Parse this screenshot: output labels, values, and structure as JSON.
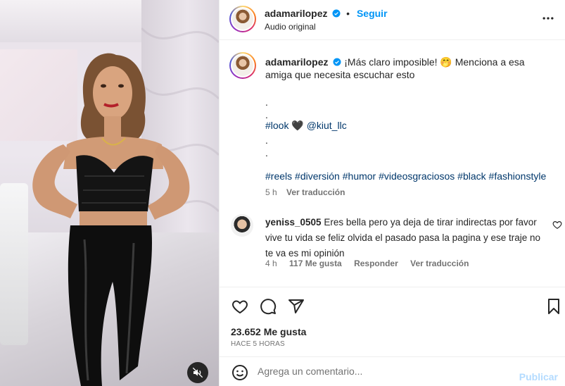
{
  "post": {
    "username": "adamarilopez",
    "follow_label": "Seguir",
    "audio_label": "Audio original",
    "caption_main": "¡Más claro imposible! 🤭 Menciona a esa amiga que necesita escuchar esto",
    "dot": ".",
    "look_tag": "#look",
    "heart_emoji": "🖤",
    "mention": "@kiut_llc",
    "hashtags": [
      "#reels",
      "#diversión",
      "#humor",
      "#videosgraciosos",
      "#black",
      "#fashionstyle"
    ],
    "caption_time": "5 h",
    "translate_label": "Ver traducción"
  },
  "comment": {
    "username": "yeniss_0505",
    "text": "Eres bella pero ya deja de tirar indirectas por favor vive tu vida se feliz olvida el pasado pasa la pagina y ese traje no te va es mi opinión",
    "time": "4 h",
    "likes": "117 Me gusta",
    "reply_label": "Responder",
    "translate_label": "Ver traducción"
  },
  "stats": {
    "likes": "23.652 Me gusta",
    "date": "HACE 5 HORAS"
  },
  "composer": {
    "placeholder": "Agrega un comentario...",
    "publish_label": "Publicar"
  },
  "icons": {
    "verified": "verified-badge-icon",
    "more": "more-options-icon",
    "like": "heart-icon",
    "comment": "comment-icon",
    "share": "share-icon",
    "save": "bookmark-icon",
    "emoji": "emoji-icon",
    "mute": "muted-speaker-icon"
  },
  "colors": {
    "accent": "#0095f6",
    "hashtag": "#00376b",
    "muted": "#737373",
    "publish_disabled": "#b3dbff"
  }
}
